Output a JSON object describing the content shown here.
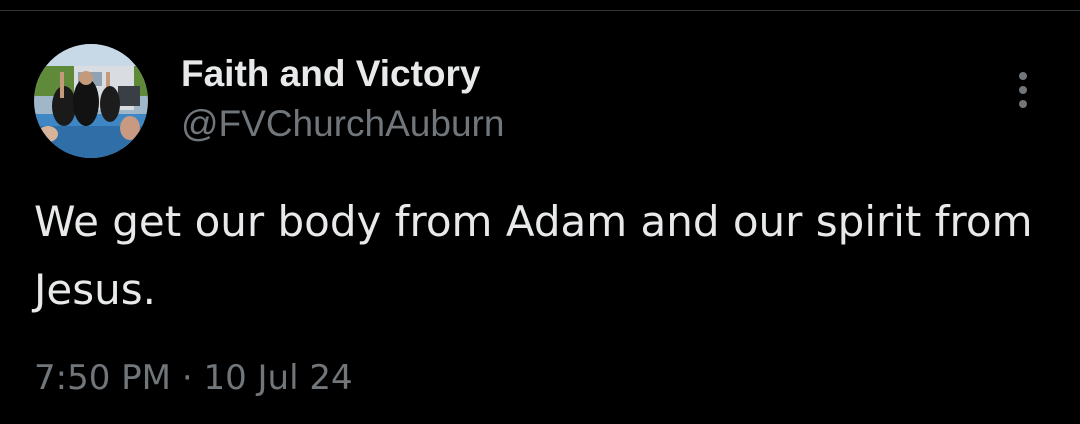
{
  "tweet": {
    "author": {
      "display_name": "Faith and Victory",
      "handle": "@FVChurchAuburn",
      "avatar_icon": "profile-photo-baptism-pool"
    },
    "text": "We get our body from Adam and our spirit from Jesus.",
    "time": "7:50 PM",
    "separator": "·",
    "date": "10 Jul 24",
    "more_icon": "more-vertical-icon"
  },
  "colors": {
    "background": "#000000",
    "primary_text": "#e7e9ea",
    "secondary_text": "#71767b",
    "divider": "#2f3336"
  }
}
